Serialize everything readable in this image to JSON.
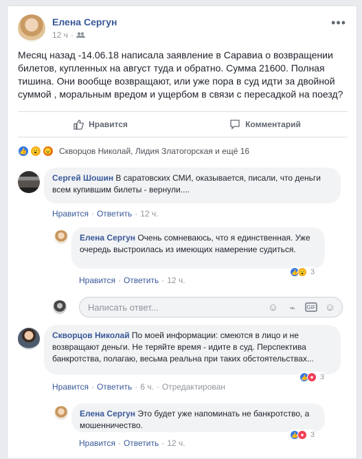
{
  "post": {
    "author": "Елена Сергун",
    "time": "12 ч",
    "privacy_icon": "friends-icon",
    "text": "Месяц назад -14.06.18 написала заявление в Саравиа о возвращении билетов, купленных на август туда и обратно. Сумма 21600. Полная тишина. Они вообще возвращают, или уже пора в суд идти за двойной суммой , моральным вредом и ущербом в связи с пересадкой на поезд?",
    "more_icon": "more-options-icon"
  },
  "actions": {
    "like": "Нравится",
    "comment": "Комментарий"
  },
  "reactions": {
    "summary": "Скворцов Николай, Лидия Златогорская и ещё 16",
    "icons": [
      "like-icon",
      "wow-icon",
      "angry-icon"
    ]
  },
  "comments": [
    {
      "author": "Сергей Шошин",
      "text": "В саратовских СМИ, оказывается, писали, что деньги всем купившим билеты - вернули....",
      "like": "Нравится",
      "reply": "Ответить",
      "time": "12 ч."
    },
    {
      "author": "Елена Сергун",
      "text": "Очень сомневаюсь, что я единственная. Уже очередь выстроилась из имеющих намерение судиться.",
      "like": "Нравится",
      "reply": "Ответить",
      "time": "12 ч.",
      "reaction_count": "3"
    },
    {
      "author": "Скворцов Николай",
      "text": "По моей информации: смеются в лицо и не возвращают деньги. Не теряйте время - идите в суд. Перспектива банкротства, полагаю, весьма реальна при таких обстоятельствах...",
      "like": "Нравится",
      "reply": "Ответить",
      "time": "6 ч.",
      "edited": "Отредактирован",
      "reaction_count": "3"
    },
    {
      "author": "Елена Сергун",
      "text": "Это будет уже напоминать не банкротство, а мошенничество.",
      "like": "Нравится",
      "reply": "Ответить",
      "time": "12 ч.",
      "reaction_count": "3"
    }
  ],
  "reply_box": {
    "placeholder": "Написать ответ...",
    "icons": [
      "emoji-icon",
      "camera-icon",
      "gif-icon",
      "sticker-icon"
    ]
  },
  "colors": {
    "link": "#385898",
    "like": "#3578e5",
    "wow": "#f7b125",
    "heart": "#f33e58"
  }
}
